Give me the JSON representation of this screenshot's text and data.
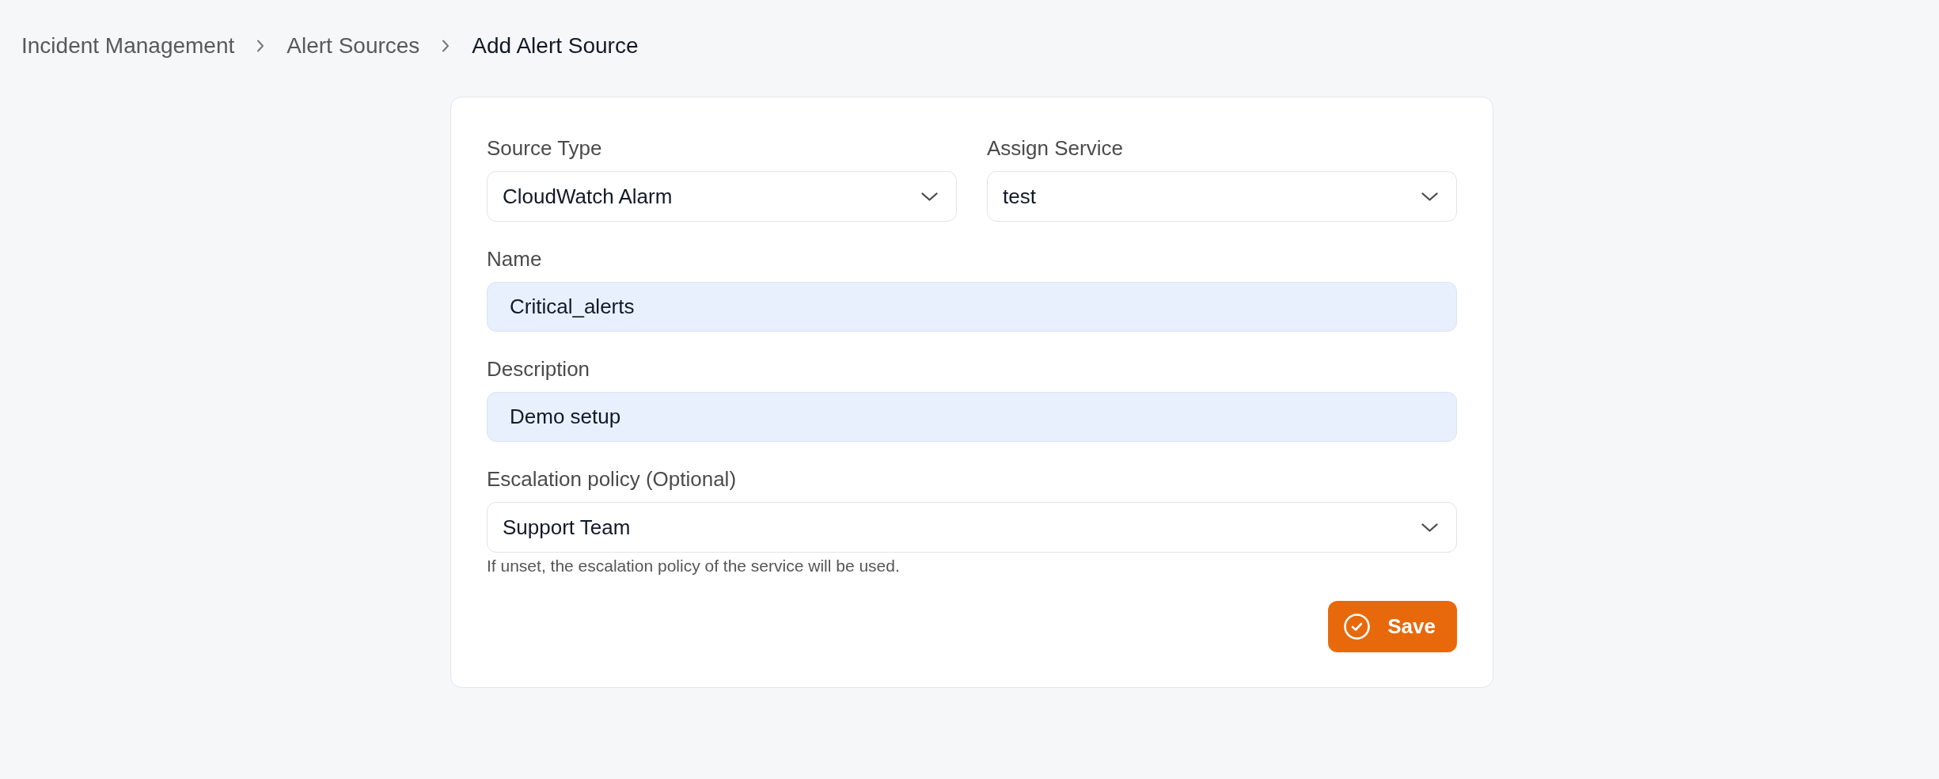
{
  "breadcrumb": [
    {
      "label": "Incident Management",
      "current": false
    },
    {
      "label": "Alert Sources",
      "current": false
    },
    {
      "label": "Add Alert Source",
      "current": true
    }
  ],
  "form": {
    "rows": [
      {
        "fields": [
          {
            "kind": "select",
            "label": "Source Type",
            "value": "CloudWatch Alarm"
          },
          {
            "kind": "select",
            "label": "Assign Service",
            "value": "test"
          }
        ]
      },
      {
        "fields": [
          {
            "kind": "input",
            "label": "Name",
            "value": "Critical_alerts",
            "autofilled": true
          }
        ]
      },
      {
        "fields": [
          {
            "kind": "input",
            "label": "Description",
            "value": "Demo setup",
            "autofilled": true
          }
        ]
      },
      {
        "fields": [
          {
            "kind": "select",
            "label": "Escalation policy (Optional)",
            "value": "Support Team",
            "hint": "If unset, the escalation policy of the service will be used."
          }
        ]
      }
    ],
    "save_button": {
      "label": "Save"
    }
  }
}
